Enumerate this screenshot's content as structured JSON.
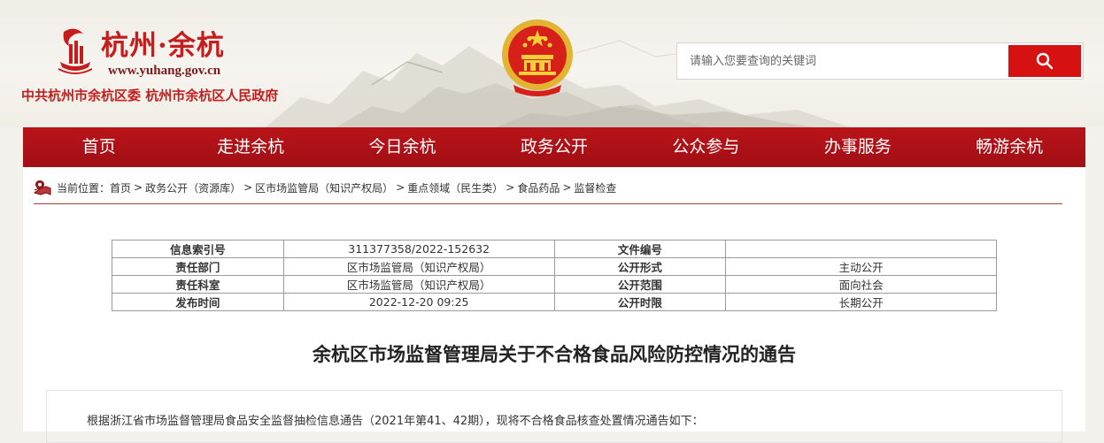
{
  "header": {
    "site_name": "杭州·余杭",
    "site_url": "www.yuhang.gov.cn",
    "org_names": "中共杭州市余杭区委  杭州市余杭区人民政府",
    "emblem_icon": "national-emblem-icon",
    "logo_icon": "yuhang-logo-icon"
  },
  "search": {
    "placeholder": "请输入您要查询的关键词",
    "value": "",
    "button_icon": "search-icon"
  },
  "nav": {
    "items": [
      {
        "label": "首页"
      },
      {
        "label": "走进余杭"
      },
      {
        "label": "今日余杭"
      },
      {
        "label": "政务公开"
      },
      {
        "label": "公众参与"
      },
      {
        "label": "办事服务"
      },
      {
        "label": "畅游余杭"
      }
    ]
  },
  "breadcrumb": {
    "icon": "location-icon",
    "prefix": "当前位置：",
    "separator": ">",
    "items": [
      {
        "label": "首页"
      },
      {
        "label": "政务公开（资源库）"
      },
      {
        "label": "区市场监管局（知识产权局）"
      },
      {
        "label": "重点领域（民生类）"
      },
      {
        "label": "食品药品"
      },
      {
        "label": "监督检查"
      }
    ]
  },
  "meta": {
    "rows": [
      {
        "label1": "信息索引号",
        "value1": "311377358/2022-152632",
        "label2": "文件编号",
        "value2": ""
      },
      {
        "label1": "责任部门",
        "value1": "区市场监管局（知识产权局）",
        "label2": "公开形式",
        "value2": "主动公开"
      },
      {
        "label1": "责任科室",
        "value1": "区市场监管局（知识产权局）",
        "label2": "公开范围",
        "value2": "面向社会"
      },
      {
        "label1": "发布时间",
        "value1": "2022-12-20 09:25",
        "label2": "公开时限",
        "value2": "长期公开"
      }
    ]
  },
  "article": {
    "title": "余杭区市场监督管理局关于不合格食品风险防控情况的通告",
    "paragraph": "根据浙江省市场监督管理局食品安全监督抽检信息通告（2021年第41、42期），现将不合格食品核查处置情况通告如下："
  },
  "colors": {
    "brand_red": "#c51d1d",
    "nav_red": "#a10f14",
    "search_button": "#d51111"
  }
}
